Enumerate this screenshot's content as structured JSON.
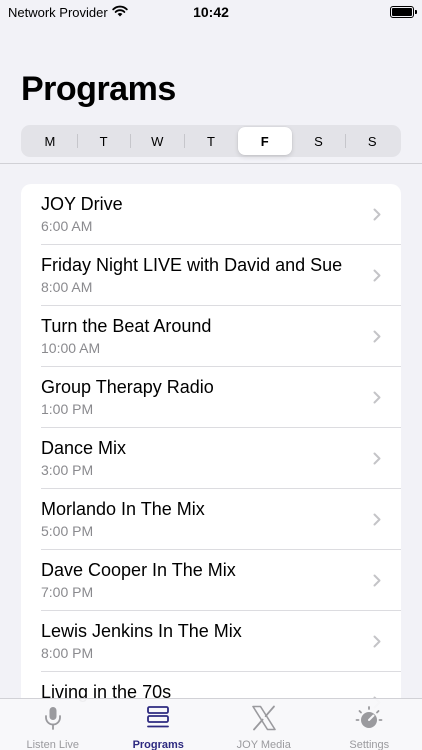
{
  "status_bar": {
    "carrier": "Network Provider",
    "time": "10:42",
    "battery_level": 1.0
  },
  "page": {
    "title": "Programs"
  },
  "day_selector": {
    "days": [
      "M",
      "T",
      "W",
      "T",
      "F",
      "S",
      "S"
    ],
    "selected_index": 4
  },
  "programs": [
    {
      "title": "JOY Drive",
      "time": "6:00 AM"
    },
    {
      "title": "Friday Night LIVE with David and Sue",
      "time": "8:00 AM"
    },
    {
      "title": "Turn the Beat Around",
      "time": "10:00 AM"
    },
    {
      "title": "Group Therapy Radio",
      "time": "1:00 PM"
    },
    {
      "title": "Dance Mix",
      "time": "3:00 PM"
    },
    {
      "title": "Morlando In The Mix",
      "time": "5:00 PM"
    },
    {
      "title": "Dave Cooper In The Mix",
      "time": "7:00 PM"
    },
    {
      "title": "Lewis Jenkins In The Mix",
      "time": "8:00 PM"
    },
    {
      "title": "Living in the 70s",
      "time": ""
    }
  ],
  "tab_bar": {
    "tabs": [
      {
        "label": "Listen Live",
        "icon": "microphone-icon"
      },
      {
        "label": "Programs",
        "icon": "list-stack-icon"
      },
      {
        "label": "JOY Media",
        "icon": "x-logo-icon"
      },
      {
        "label": "Settings",
        "icon": "gauge-icon"
      }
    ],
    "active_index": 1
  },
  "colors": {
    "accent": "#2d2a80",
    "inactive": "#9a9a9e",
    "background": "#f2f2f7"
  }
}
